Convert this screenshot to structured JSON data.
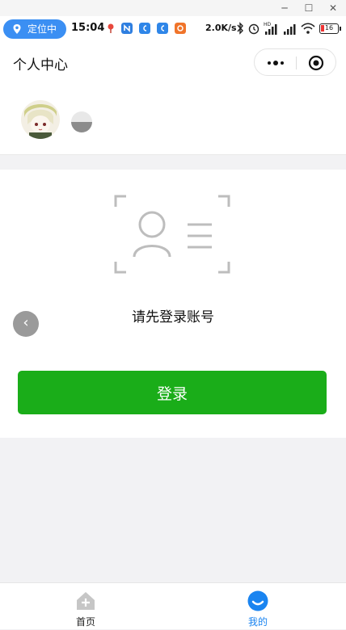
{
  "window_controls": {
    "minimize": "─",
    "maximize": "☐",
    "close": "✕"
  },
  "status_bar": {
    "location_label": "定位中",
    "time": "15:04",
    "net_speed": "2.0K/s",
    "battery": "16",
    "accent": "#3b8ff3"
  },
  "header": {
    "title": "个人中心"
  },
  "login": {
    "prompt": "请先登录账号",
    "button_label": "登录",
    "button_color": "#1aad19",
    "back_glyph": "‹"
  },
  "tabbar": {
    "items": [
      {
        "label": "首页",
        "icon": "home-icon",
        "active": false
      },
      {
        "label": "我的",
        "icon": "profile-smile-icon",
        "active": true
      }
    ],
    "active_color": "#1a84f0",
    "inactive_color": "#222222"
  }
}
